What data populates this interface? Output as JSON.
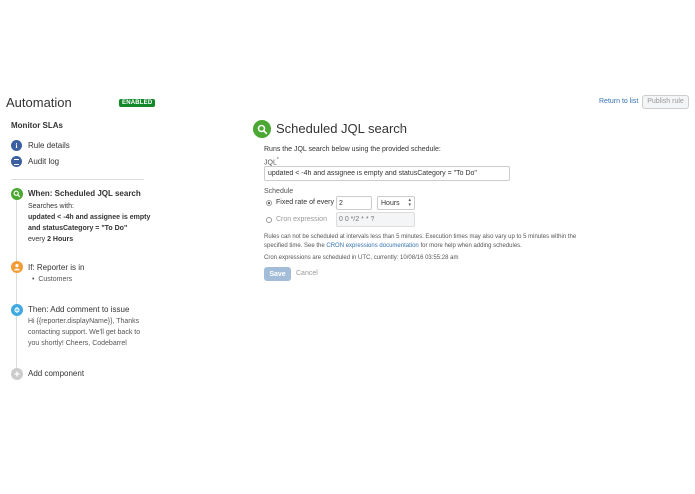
{
  "header": {
    "title": "Automation",
    "status_badge": "ENABLED",
    "return_link": "Return to list",
    "publish_button": "Publish rule"
  },
  "sidebar": {
    "rule_name": "Monitor SLAs",
    "links": [
      {
        "label": "Rule details",
        "icon": "info-icon"
      },
      {
        "label": "Audit log",
        "icon": "list-icon"
      }
    ],
    "steps": {
      "when": {
        "title": "When: Scheduled JQL search",
        "searches_with": "Searches with:",
        "query_line1": "updated < -4h and assignee is empty",
        "query_line2": "and statusCategory = \"To Do\"",
        "every_prefix": "every",
        "every_value": "2 Hours"
      },
      "if": {
        "title": "If: Reporter is in",
        "item": "Customers"
      },
      "then": {
        "title": "Then: Add comment to issue",
        "line1": "Hi {{reporter.displayName}}, Thanks",
        "line2": "contacting support. We'll get back to",
        "line3": "you shortly! Cheers, Codebarrel"
      },
      "add": {
        "title": "Add component"
      }
    }
  },
  "main": {
    "title": "Scheduled JQL search",
    "description": "Runs the JQL search below using the provided schedule:",
    "jql_label": "JQL",
    "jql_required_mark": "*",
    "jql_value": "updated < -4h and assignee is empty and statusCategory = \"To Do\"",
    "schedule_label": "Schedule",
    "fixed_rate_label": "Fixed rate of every",
    "fixed_rate_value": "2",
    "fixed_rate_unit": "Hours",
    "cron_label": "Cron expression",
    "cron_placeholder": "0 0 */2 * * ?",
    "note_line1": "Rules can not be scheduled at intervals less than 5 minutes. Execution times may also vary up to 5 minutes within the",
    "note_line2_prefix": "specified time. See the",
    "note_link": "CRON expressions documentation",
    "note_line2_suffix": "for more help when adding schedules.",
    "utc_note": "Cron expressions are scheduled in UTC, currently: 10/08/16 03:55:28 am",
    "save_button": "Save",
    "cancel_link": "Cancel"
  },
  "colors": {
    "enabled_badge": "#14892c",
    "link": "#3572b0",
    "when_icon": "#4aa832",
    "if_icon": "#f29d38",
    "then_icon": "#3fa9e0",
    "add_icon": "#cccccc",
    "save_disabled": "#a3bcd8"
  }
}
